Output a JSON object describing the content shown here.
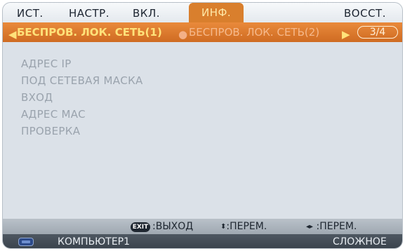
{
  "tabs": [
    "ИСТ.",
    "НАСТР.",
    "ВКЛ.",
    "ИНФ.",
    "ВОССТ."
  ],
  "subtabs": {
    "active": "БЕСПРОВ. ЛОК. СЕТЬ(1)",
    "inactive": "БЕСПРОВ. ЛОК. СЕТЬ(2)",
    "page": "3/4"
  },
  "items": [
    "АДРЕС IP",
    "ПОД СЕТЕВАЯ МАСКА",
    "ВХОД",
    "АДРЕС MAC",
    "ПРОВЕРКА"
  ],
  "hints": {
    "exit_key": "EXIT",
    "exit_label": ":ВЫХОД",
    "updown_label": ":ПЕРЕМ.",
    "leftright_label": ":ПЕРЕМ."
  },
  "status": {
    "source": "КОМПЬЮТЕР1",
    "mode": "СЛОЖНОЕ"
  },
  "colors": {
    "accent": "#d97f2d",
    "active_text": "#ffe27a",
    "menu_bg": "#dbe1e8"
  }
}
